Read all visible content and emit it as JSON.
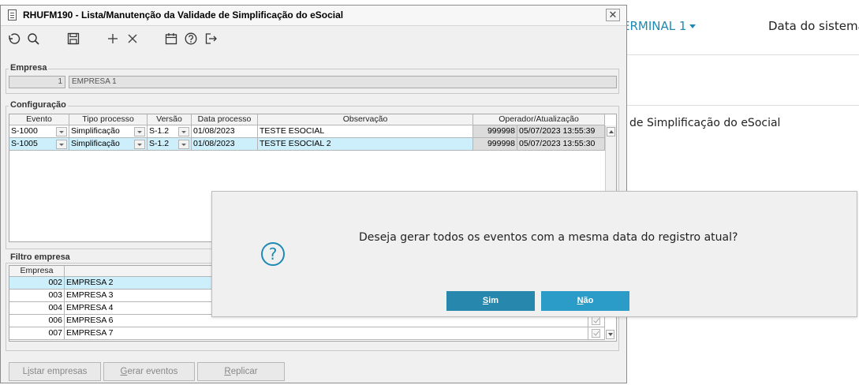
{
  "background": {
    "terminal_label": "ERMINAL 1",
    "date_label": "Data do sistema:",
    "subtitle": "de Simplificação do eSocial"
  },
  "window": {
    "title": "RHUFM190 - Lista/Manutenção da Validade de Simplificação do eSocial",
    "close_glyph": "✕"
  },
  "toolbar": {
    "icons": [
      "undo-icon",
      "search-icon",
      "save-icon",
      "add-icon",
      "delete-icon",
      "calendar-icon",
      "help-icon",
      "exit-icon"
    ]
  },
  "empresa": {
    "label": "Empresa",
    "code": "1",
    "name": "EMPRESA 1"
  },
  "configuracao": {
    "label": "Configuração",
    "headers": [
      "Evento",
      "Tipo processo",
      "Versão",
      "Data processo",
      "Observação",
      "Operador/Atualização"
    ],
    "rows": [
      {
        "evento": "S-1000",
        "tipo": "Simplificação",
        "versao": "S-1.2",
        "data": "01/08/2023",
        "obs": "TESTE ESOCIAL",
        "operador": "999998",
        "atualizacao": "05/07/2023 13:55:39"
      },
      {
        "evento": "S-1005",
        "tipo": "Simplificação",
        "versao": "S-1.2",
        "data": "01/08/2023",
        "obs": "TESTE ESOCIAL 2",
        "operador": "999998",
        "atualizacao": "05/07/2023 13:55:30"
      }
    ]
  },
  "filtro": {
    "label": "Filtro empresa",
    "header": "Empresa",
    "rows": [
      {
        "code": "002",
        "name": "EMPRESA 2"
      },
      {
        "code": "003",
        "name": "EMPRESA 3"
      },
      {
        "code": "004",
        "name": "EMPRESA 4"
      },
      {
        "code": "006",
        "name": "EMPRESA 6"
      },
      {
        "code": "007",
        "name": "EMPRESA 7"
      }
    ]
  },
  "buttons": {
    "listar_pre": "L",
    "listar_ul": "i",
    "listar_post": "star empresas",
    "gerar_pre": "",
    "gerar_ul": "G",
    "gerar_post": "erar eventos",
    "replicar_pre": "",
    "replicar_ul": "R",
    "replicar_post": "eplicar"
  },
  "dialog": {
    "icon_glyph": "?",
    "message": "Deseja gerar todos os eventos com a mesma data do registro atual?",
    "sim_ul": "S",
    "sim_rest": "im",
    "nao_ul": "N",
    "nao_rest": "ão"
  },
  "colors": {
    "accent": "#1e8ab3",
    "selected_row": "#cdeffb",
    "dialog_button": "#2a94bd"
  }
}
